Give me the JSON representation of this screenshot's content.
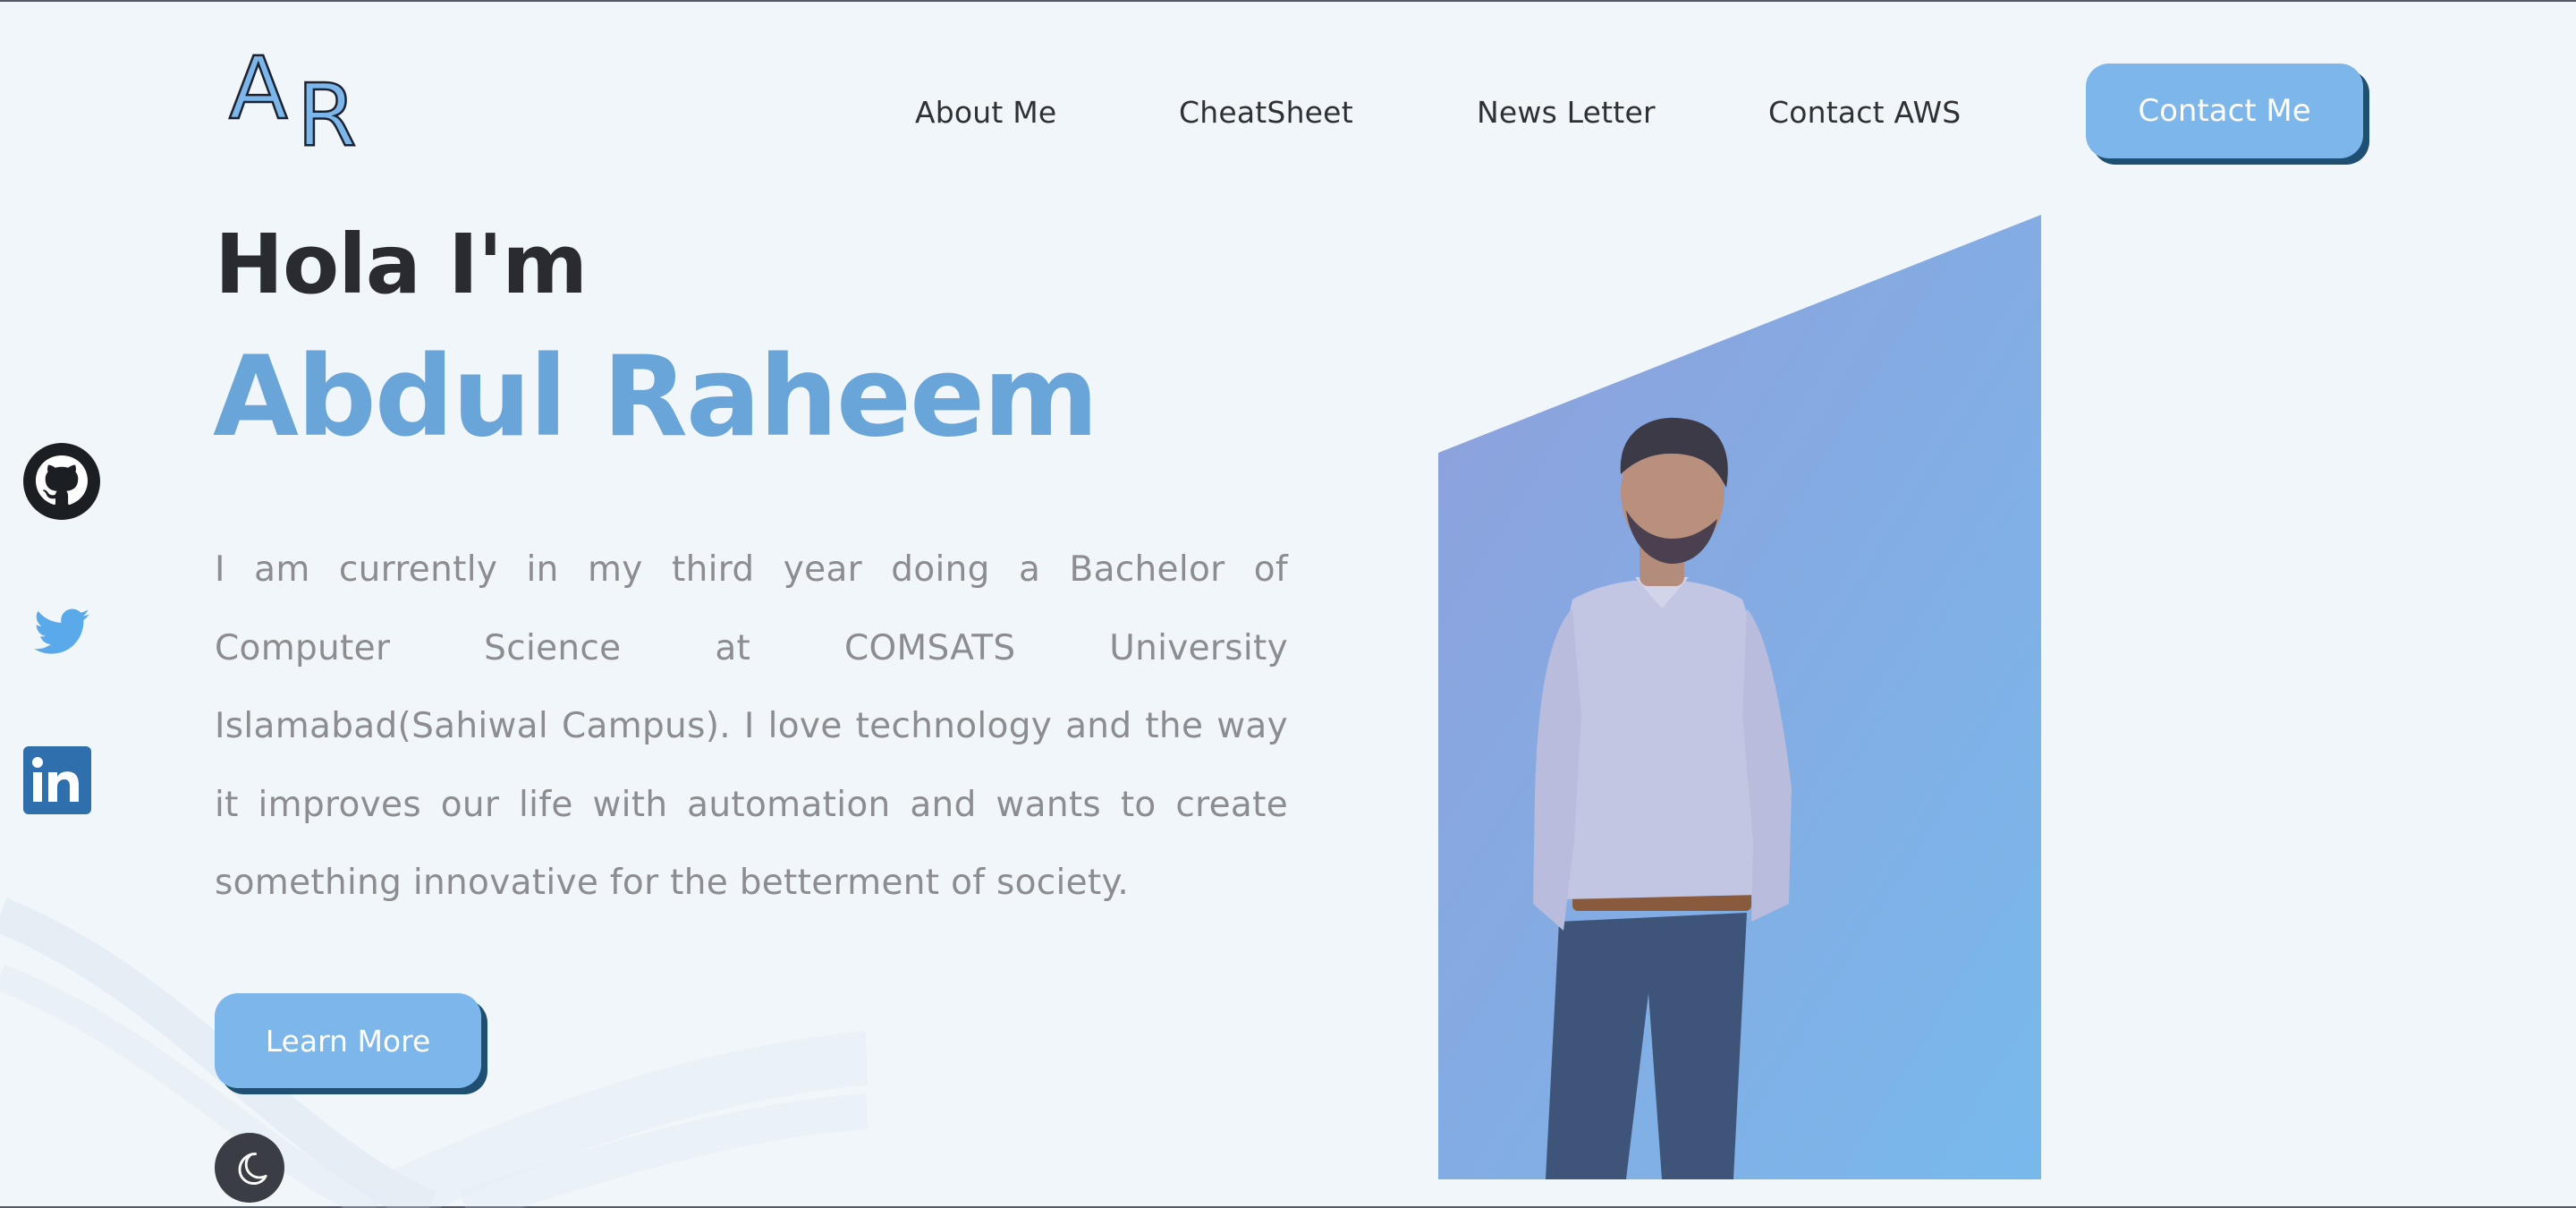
{
  "brand": {
    "logo_text": "AR",
    "logo_letters": [
      "A",
      "R"
    ]
  },
  "nav": {
    "links": [
      {
        "label": "About Me"
      },
      {
        "label": "CheatSheet"
      },
      {
        "label": "News Letter"
      },
      {
        "label": "Contact AWS"
      }
    ],
    "cta_label": "Contact Me"
  },
  "hero": {
    "greeting": "Hola I'm",
    "name": "Abdul Raheem",
    "bio": "I am currently in my third year doing a Bachelor of Computer Science at COMSATS University Islamabad(Sahiwal Campus). I love technology and the way it improves our life with automation and wants to create something innovative for the betterment of society.",
    "learn_more_label": "Learn More"
  },
  "social": [
    {
      "name": "github-icon"
    },
    {
      "name": "twitter-icon"
    },
    {
      "name": "linkedin-icon"
    }
  ],
  "theme_toggle": {
    "icon": "moon-icon"
  },
  "colors": {
    "accent": "#7cb6ea",
    "accent_shadow": "#1f4f73",
    "name_blue": "#6aa5da",
    "background": "#f0f6fa",
    "body_text": "#8b8d92",
    "heading": "#2a2b31"
  }
}
